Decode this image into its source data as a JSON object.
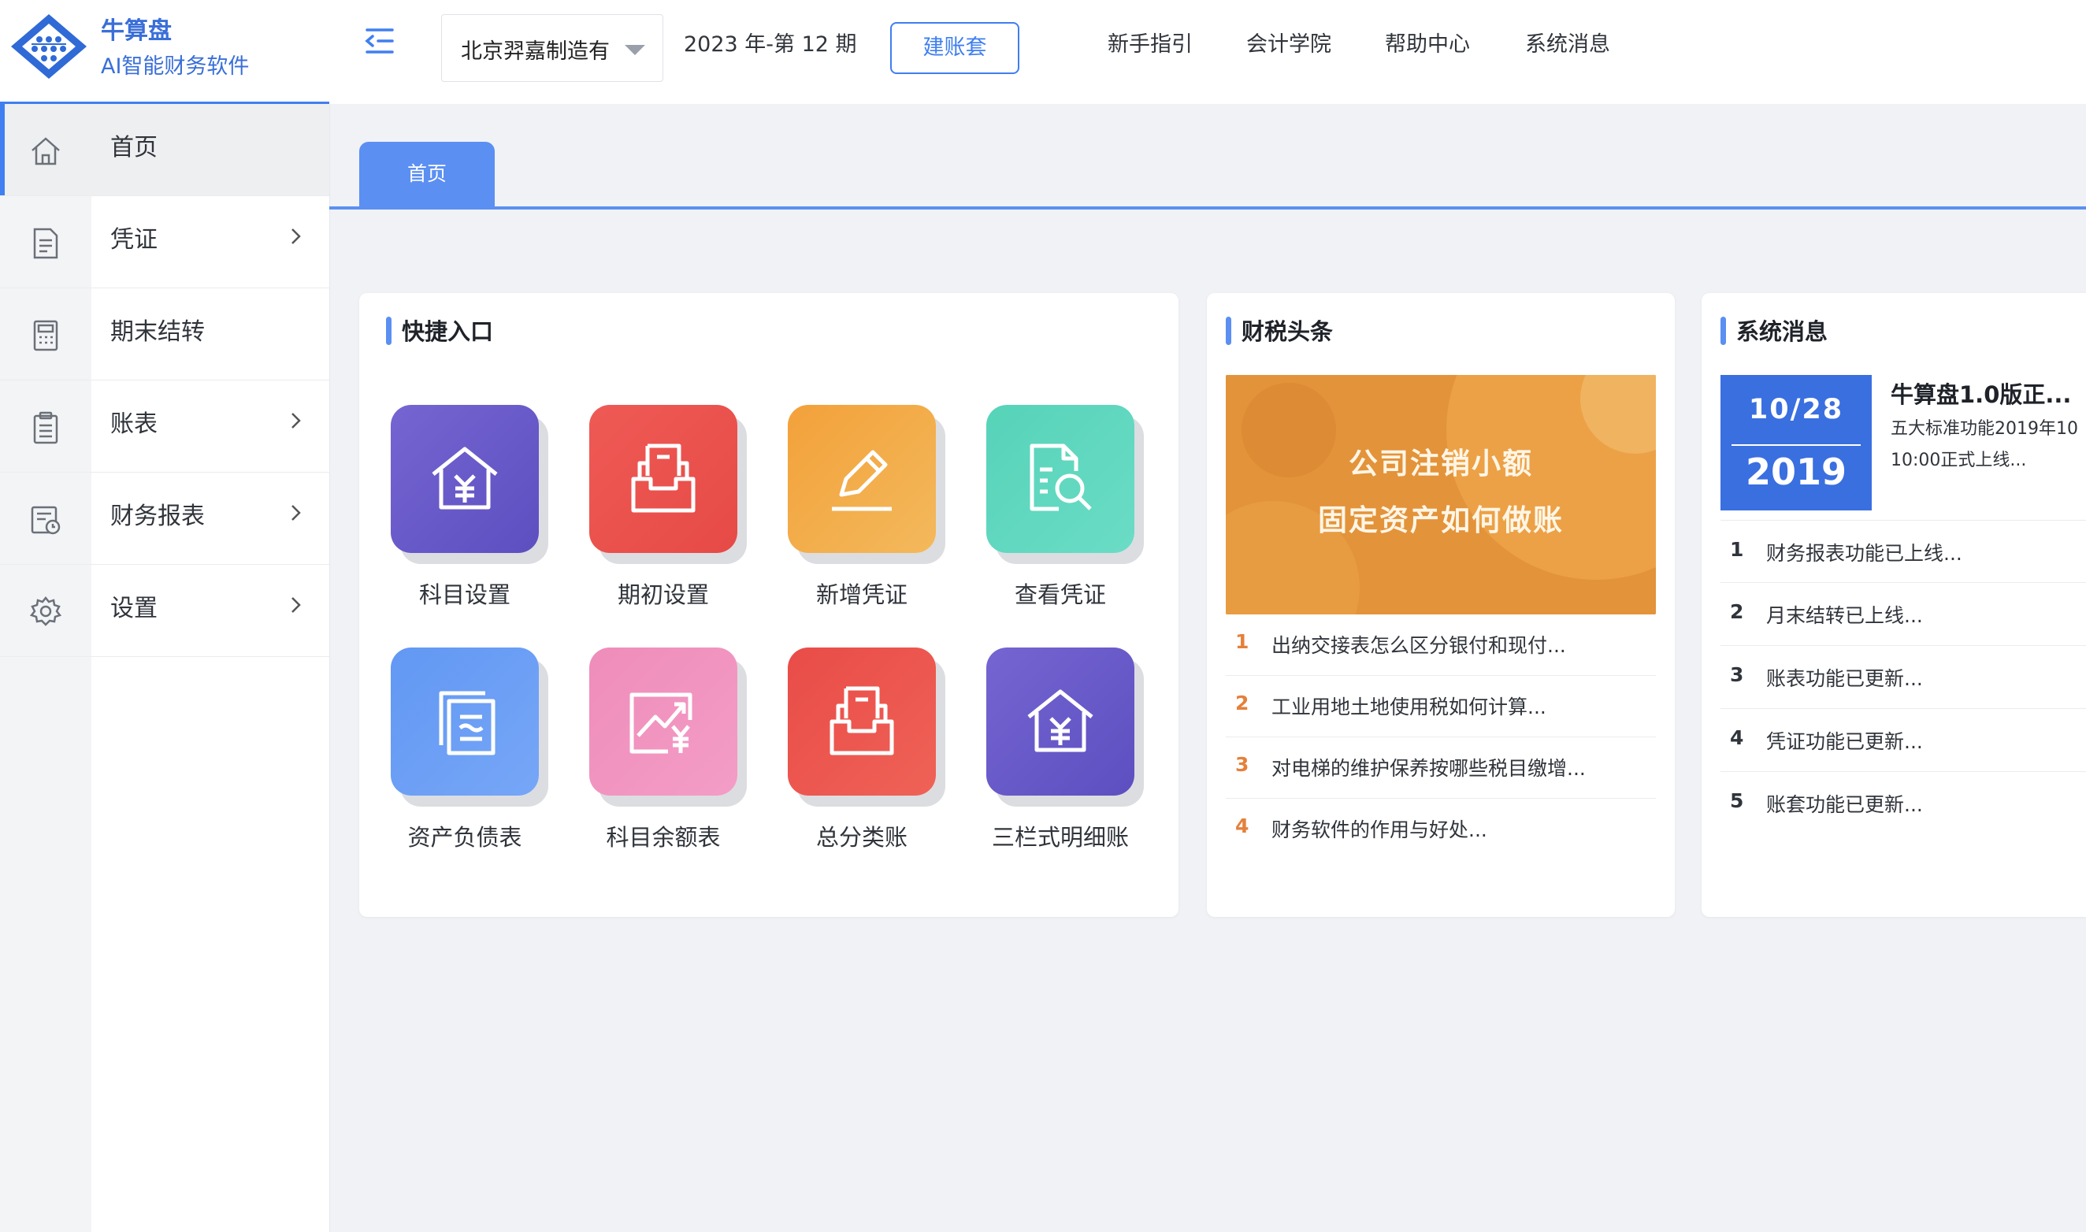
{
  "brand": {
    "name": "牛算盘",
    "slogan": "AI智能财务软件",
    "logo_icon": "abacus-diamond-logo"
  },
  "sidebar": {
    "items": [
      {
        "label": "首页",
        "icon": "home-icon",
        "active": true,
        "has_submenu": false
      },
      {
        "label": "凭证",
        "icon": "voucher-document-icon",
        "active": false,
        "has_submenu": true
      },
      {
        "label": "期末结转",
        "icon": "calculator-icon",
        "active": false,
        "has_submenu": false
      },
      {
        "label": "账表",
        "icon": "clipboard-icon",
        "active": false,
        "has_submenu": true
      },
      {
        "label": "财务报表",
        "icon": "report-icon",
        "active": false,
        "has_submenu": true
      },
      {
        "label": "设置",
        "icon": "gear-icon",
        "active": false,
        "has_submenu": true
      }
    ]
  },
  "header": {
    "company": "北京羿嘉制造有",
    "period": "2023 年-第 12 期",
    "create_button": "建账套",
    "links": [
      "新手指引",
      "会计学院",
      "帮助中心",
      "系统消息"
    ]
  },
  "tabs": [
    {
      "label": "首页",
      "active": true
    }
  ],
  "quick_entry": {
    "title": "快捷入口",
    "items": [
      {
        "label": "科目设置",
        "icon": "house-yen-icon",
        "color": "#6b5ec9"
      },
      {
        "label": "期初设置",
        "icon": "inbox-tray-icon",
        "color": "#e9534d"
      },
      {
        "label": "新增凭证",
        "icon": "pencil-edit-icon",
        "color": "#f0a23d"
      },
      {
        "label": "查看凭证",
        "icon": "document-search-icon",
        "color": "#5ed6bd"
      },
      {
        "label": "资产负债表",
        "icon": "stacked-documents-icon",
        "color": "#6a9bf5"
      },
      {
        "label": "科目余额表",
        "icon": "chart-yen-icon",
        "color": "#f092bf"
      },
      {
        "label": "总分类账",
        "icon": "inbox-tray-icon",
        "color": "#e9534d"
      },
      {
        "label": "三栏式明细账",
        "icon": "house-yen-icon",
        "color": "#6b5ec9"
      }
    ]
  },
  "tax_news": {
    "title": "财税头条",
    "banner_line1": "公司注销小额",
    "banner_line2": "固定资产如何做账",
    "items": [
      {
        "num": "1",
        "text": "出纳交接表怎么区分银付和现付..."
      },
      {
        "num": "2",
        "text": "工业用地土地使用税如何计算..."
      },
      {
        "num": "3",
        "text": "对电梯的维护保养按哪些税目缴增..."
      },
      {
        "num": "4",
        "text": "财务软件的作用与好处..."
      }
    ]
  },
  "system_messages": {
    "title": "系统消息",
    "featured": {
      "month_day": "10/28",
      "year": "2019",
      "headline": "牛算盘1.0版正...",
      "line1": "五大标准功能2019年10",
      "line2": "10:00正式上线..."
    },
    "items": [
      {
        "num": "1",
        "text": "财务报表功能已上线..."
      },
      {
        "num": "2",
        "text": "月末结转已上线..."
      },
      {
        "num": "3",
        "text": "账表功能已更新..."
      },
      {
        "num": "4",
        "text": "凭证功能已更新..."
      },
      {
        "num": "5",
        "text": "账套功能已更新..."
      }
    ]
  }
}
